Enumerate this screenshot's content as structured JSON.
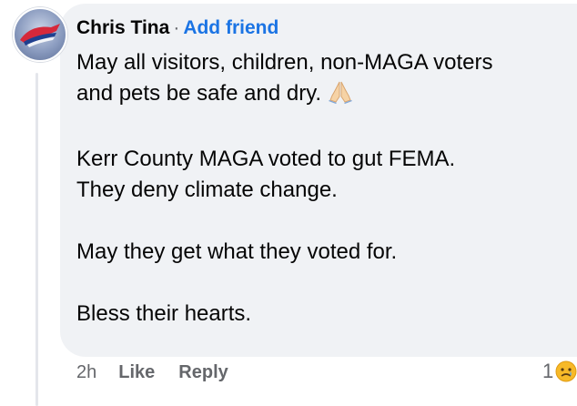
{
  "comment": {
    "author": "Chris Tina",
    "separator": "·",
    "add_friend_label": "Add friend",
    "paragraphs": [
      {
        "lines": [
          "May all visitors, children, non-MAGA voters",
          "and pets be safe and dry."
        ],
        "emoji": "pray-icon"
      },
      {
        "lines": [
          "Kerr County MAGA voted to gut FEMA.",
          "They deny climate change."
        ]
      },
      {
        "lines": [
          "May they get what they voted for."
        ]
      },
      {
        "lines": [
          "Bless their hearts."
        ]
      }
    ]
  },
  "actions": {
    "time": "2h",
    "like_label": "Like",
    "reply_label": "Reply"
  },
  "reactions": {
    "count": "1",
    "icon": "sad-face-icon"
  },
  "colors": {
    "bubble": "#f0f2f5",
    "link": "#1b74e4",
    "text": "#050505",
    "meta": "#65676b"
  }
}
